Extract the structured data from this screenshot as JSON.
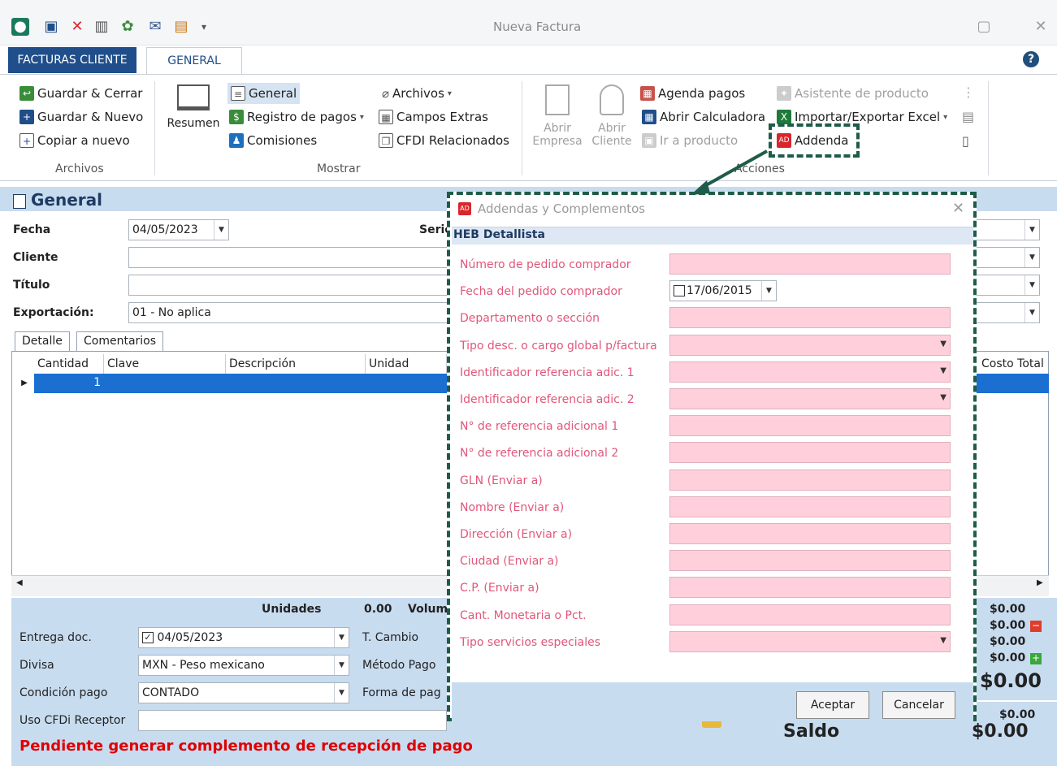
{
  "window": {
    "title": "Nueva Factura"
  },
  "tabs": {
    "file": "FACTURAS CLIENTE",
    "active": "GENERAL"
  },
  "ribbon": {
    "archivos": {
      "save_close": "Guardar & Cerrar",
      "save_new": "Guardar & Nuevo",
      "copy_new": "Copiar a nuevo",
      "group": "Archivos"
    },
    "mostrar": {
      "resumen": "Resumen",
      "general": "General",
      "registro_pagos": "Registro de pagos",
      "comisiones": "Comisiones",
      "archivos": "Archivos",
      "campos_extras": "Campos Extras",
      "cfdi_relacionados": "CFDI Relacionados",
      "group": "Mostrar"
    },
    "acciones": {
      "abrir_empresa": "Abrir Empresa",
      "abrir_cliente": "Abrir Cliente",
      "agenda_pagos": "Agenda pagos",
      "abrir_calculadora": "Abrir Calculadora",
      "ir_producto": "Ir a producto",
      "asistente_producto": "Asistente de producto",
      "importar_excel": "Importar/Exportar Excel",
      "addenda": "Addenda",
      "group": "Acciones"
    }
  },
  "section": {
    "title": "General"
  },
  "form": {
    "fecha_label": "Fecha",
    "fecha_value": "04/05/2023",
    "serie_label": "Serie",
    "cliente_label": "Cliente",
    "titulo_label": "Título",
    "exportacion_label": "Exportación:",
    "exportacion_value": "01 - No aplica"
  },
  "grid": {
    "tabs": [
      "Detalle",
      "Comentarios"
    ],
    "columns": [
      "Cantidad",
      "Clave",
      "Descripción",
      "Unidad",
      "Costo Total"
    ],
    "row_qty": "1"
  },
  "footer": {
    "unidades_label": "Unidades",
    "unidades_value": "0.00",
    "volumen_label": "Volum",
    "entrega_label": "Entrega doc.",
    "entrega_value": "04/05/2023",
    "tcambio_label": "T. Cambio",
    "divisa_label": "Divisa",
    "divisa_value": "MXN - Peso mexicano",
    "metodo_label": "Método Pago",
    "condicion_label": "Condición pago",
    "condicion_value": "CONTADO",
    "forma_label": "Forma de pag",
    "uso_label": "Uso CFDi Receptor",
    "warning": "Pendiente generar complemento de recepción de pago",
    "totals": [
      "$0.00",
      "$0.00",
      "$0.00",
      "$0.00"
    ],
    "total_big": "$0.00",
    "saldo_small": "$0.00",
    "saldo_label": "Saldo",
    "saldo_value": "$0.00"
  },
  "dialog": {
    "title": "Addendas y Complementos",
    "subtitle": "HEB Detallista",
    "fecha_pedido_value": "17/06/2015",
    "fields": [
      "Número de pedido comprador",
      "Fecha del pedido comprador",
      "Departamento o sección",
      "Tipo desc. o cargo global p/factura",
      "Identificador referencia adic. 1",
      "Identificador referencia adic. 2",
      "N° de referencia adicional 1",
      "N° de referencia adicional 2",
      "GLN (Enviar a)",
      "Nombre (Enviar a)",
      "Dirección (Enviar a)",
      "Ciudad (Enviar a)",
      "C.P. (Enviar a)",
      "Cant. Monetaria o Pct.",
      "Tipo servicios especiales"
    ],
    "accept": "Aceptar",
    "cancel": "Cancelar"
  },
  "colors": {
    "accent": "#1f4e8a",
    "highlight_border": "#1e5c4a",
    "pink_field": "#ffd0dc",
    "warning": "#e00000"
  }
}
